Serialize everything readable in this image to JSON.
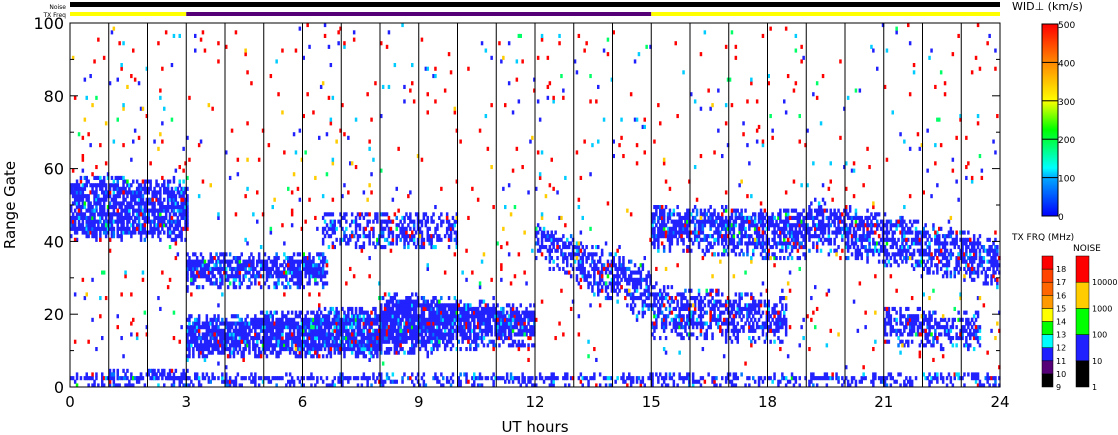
{
  "chart_data": {
    "type": "heatmap",
    "title": "",
    "xlabel": "UT hours",
    "ylabel": "Range Gate",
    "xlim": [
      0,
      24
    ],
    "ylim": [
      0,
      100
    ],
    "xticks": [
      "0",
      "3",
      "6",
      "9",
      "12",
      "15",
      "18",
      "21",
      "24"
    ],
    "yticks": [
      "0",
      "20",
      "40",
      "60",
      "80",
      "100"
    ],
    "grid": "vertical lines each hour",
    "status_bars": {
      "noise_label": "Noise",
      "txfreq_label": "TX Freq",
      "noise_color": "#000000",
      "txfreq_segments": [
        {
          "from": 0,
          "to": 3,
          "color": "#ffff00"
        },
        {
          "from": 3,
          "to": 15,
          "color": "#550077"
        },
        {
          "from": 15,
          "to": 24,
          "color": "#ffff00"
        }
      ]
    },
    "echo_regions": [
      {
        "t0": 0,
        "t1": 3,
        "g0a": 40,
        "g1a": 58,
        "g0b": 40,
        "g1b": 56,
        "density": 0.75
      },
      {
        "t0": 1,
        "t1": 3,
        "g0a": 2,
        "g1a": 5,
        "g0b": 2,
        "g1b": 5,
        "density": 0.9
      },
      {
        "t0": 3,
        "t1": 6.6,
        "g0a": 27,
        "g1a": 37,
        "g0b": 28,
        "g1b": 36,
        "density": 0.8
      },
      {
        "t0": 6.5,
        "t1": 10,
        "g0a": 38,
        "g1a": 47,
        "g0b": 38,
        "g1b": 48,
        "density": 0.5
      },
      {
        "t0": 3,
        "t1": 8,
        "g0a": 8,
        "g1a": 19,
        "g0b": 8,
        "g1b": 22,
        "density": 0.85
      },
      {
        "t0": 8,
        "t1": 12,
        "g0a": 9,
        "g1a": 26,
        "g0b": 12,
        "g1b": 22,
        "density": 0.85
      },
      {
        "t0": 0,
        "t1": 24,
        "g0a": 0,
        "g1a": 4,
        "g0b": 0,
        "g1b": 4,
        "density": 0.55
      },
      {
        "t0": 12,
        "t1": 15,
        "g0a": 35,
        "g1a": 45,
        "g0b": 18,
        "g1b": 32,
        "density": 0.6
      },
      {
        "t0": 15,
        "t1": 19,
        "g0a": 38,
        "g1a": 50,
        "g0b": 35,
        "g1b": 48,
        "density": 0.7
      },
      {
        "t0": 15,
        "t1": 18.5,
        "g0a": 14,
        "g1a": 28,
        "g0b": 12,
        "g1b": 24,
        "density": 0.55
      },
      {
        "t0": 19,
        "t1": 24,
        "g0a": 38,
        "g1a": 52,
        "g0b": 28,
        "g1b": 40,
        "density": 0.6
      },
      {
        "t0": 21,
        "t1": 23.5,
        "g0a": 12,
        "g1a": 22,
        "g0b": 10,
        "g1b": 20,
        "density": 0.6
      },
      {
        "t0": 0,
        "t1": 24,
        "g0a": 5,
        "g1a": 100,
        "g0b": 5,
        "g1b": 100,
        "density": 0.02
      }
    ],
    "colorbars": [
      {
        "name": "velocity-width",
        "label": "WID⊥ (km/s)",
        "ticks": [
          "0",
          "100",
          "200",
          "300",
          "400",
          "500"
        ],
        "range": [
          0,
          500
        ]
      },
      {
        "name": "tx-frequency",
        "label": "TX FRQ (MHz)",
        "ticks": [
          "9",
          "10",
          "11",
          "12",
          "13",
          "14",
          "15",
          "16",
          "17",
          "18"
        ],
        "colors": [
          "#000000",
          "#550077",
          "#2020ff",
          "#00ffff",
          "#00ff00",
          "#ffff00",
          "#ff9900",
          "#ff6600",
          "#ff4400",
          "#ff0000"
        ]
      },
      {
        "name": "noise",
        "label": "NOISE",
        "ticks": [
          "1",
          "10",
          "100",
          "1000",
          "10000"
        ],
        "colors": [
          "#000000",
          "#2020ff",
          "#00ff00",
          "#ffcc00",
          "#ff0000"
        ]
      }
    ]
  }
}
